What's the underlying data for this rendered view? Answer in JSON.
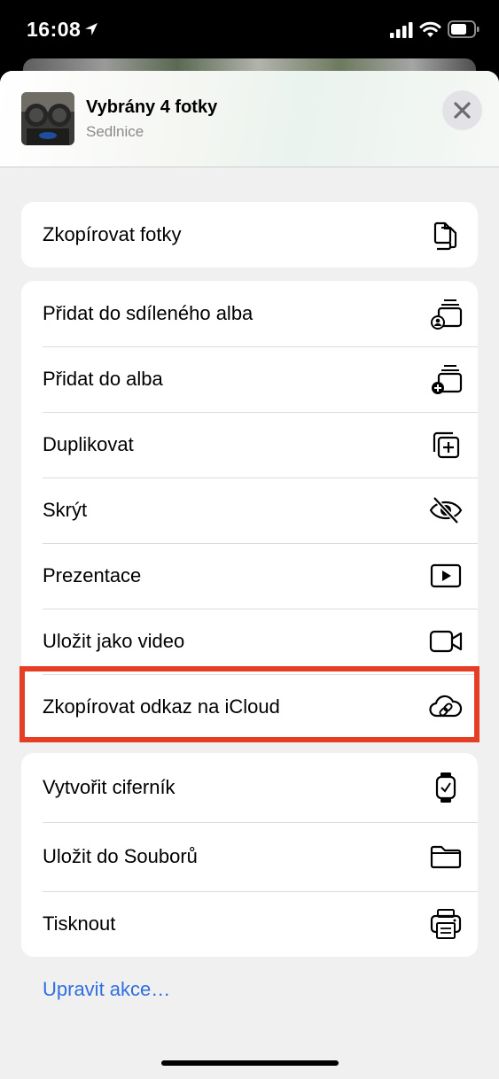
{
  "status_bar": {
    "time": "16:08"
  },
  "header": {
    "title": "Vybrány 4 fotky",
    "subtitle": "Sedlnice"
  },
  "groups": [
    {
      "items": [
        {
          "label": "Zkopírovat fotky",
          "icon": "copy-icon"
        }
      ]
    },
    {
      "items": [
        {
          "label": "Přidat do sdíleného alba",
          "icon": "shared-album-icon"
        },
        {
          "label": "Přidat do alba",
          "icon": "add-album-icon"
        },
        {
          "label": "Duplikovat",
          "icon": "duplicate-icon"
        },
        {
          "label": "Skrýt",
          "icon": "eye-slash-icon"
        },
        {
          "label": "Prezentace",
          "icon": "play-icon"
        },
        {
          "label": "Uložit jako video",
          "icon": "video-icon"
        },
        {
          "label": "Zkopírovat odkaz na iCloud",
          "icon": "icloud-link-icon"
        }
      ]
    },
    {
      "items": [
        {
          "label": "Vytvořit ciferník",
          "icon": "watch-icon"
        },
        {
          "label": "Uložit do Souborů",
          "icon": "folder-icon"
        },
        {
          "label": "Tisknout",
          "icon": "printer-icon"
        }
      ]
    }
  ],
  "edit_actions": "Upravit akce…",
  "colors": {
    "accent": "#2f6fde",
    "highlight": "#e63e24",
    "sheet_bg": "#f0f0f0"
  }
}
